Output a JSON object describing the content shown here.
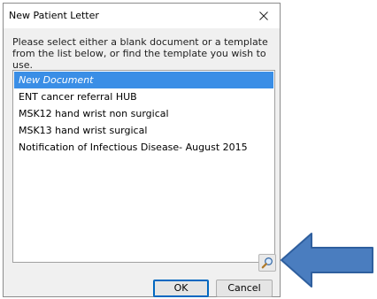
{
  "dialog": {
    "title": "New Patient Letter",
    "close_icon": "close-icon",
    "instructions": "Please select either a blank document or a template from the list below, or find the template you wish to use.",
    "templates": [
      "New Document",
      "ENT cancer referral HUB",
      "MSK12 hand wrist non surgical",
      "MSK13 hand wrist surgical",
      "Notification of Infectious Disease- August 2015"
    ],
    "selected_index": 0,
    "search_icon": "magnifier-icon",
    "ok_label": "OK",
    "cancel_label": "Cancel"
  },
  "annotation": {
    "arrow_icon": "left-arrow-icon",
    "arrow_color": "#4a7dbf"
  },
  "colors": {
    "selection": "#3a8ee6",
    "dialog_bg": "#f0f0f0"
  }
}
